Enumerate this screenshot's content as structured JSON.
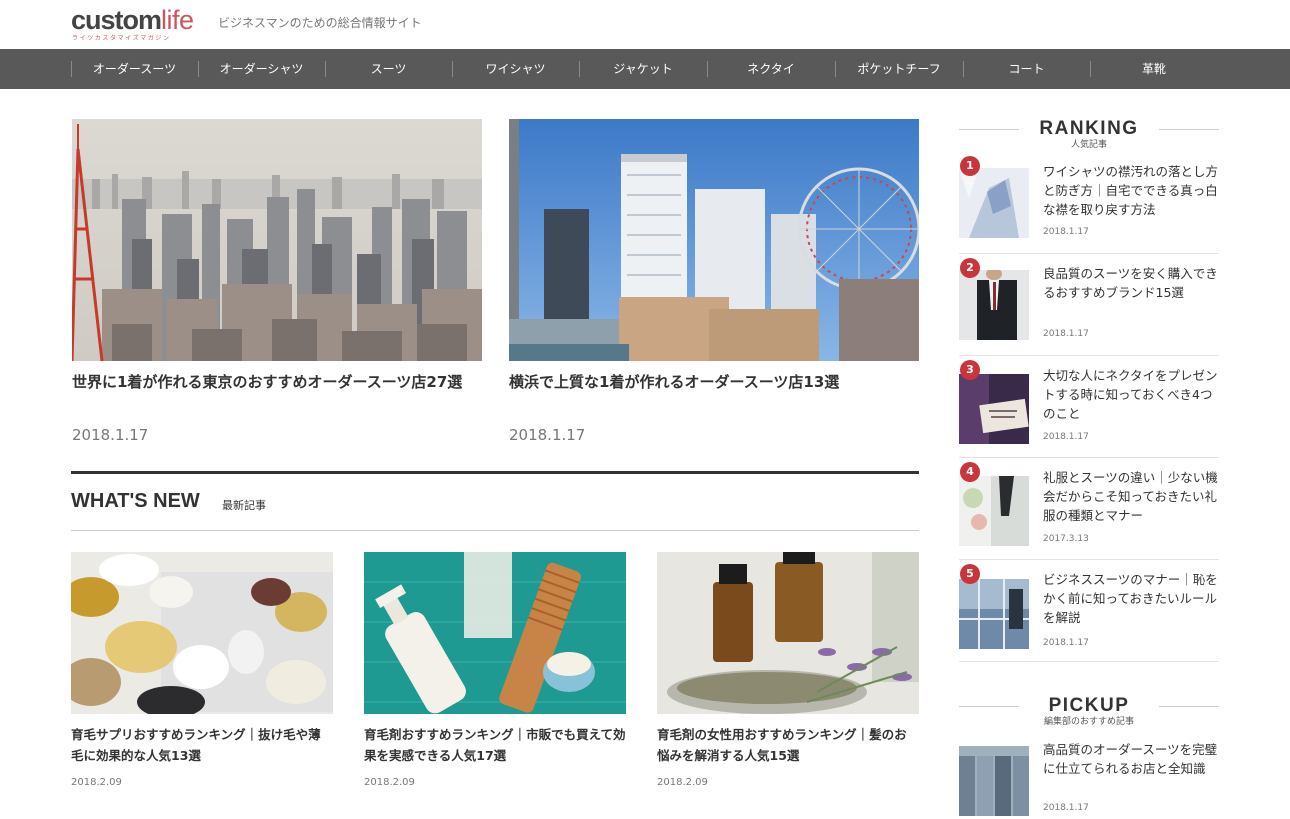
{
  "header": {
    "logo_main": "custom",
    "logo_accent": "life",
    "logo_sub": "ライツカスタマイズマガジン",
    "tagline": "ビジネスマンのための総合情報サイト"
  },
  "nav": {
    "items": [
      "オーダースーツ",
      "オーダーシャツ",
      "スーツ",
      "ワイシャツ",
      "ジャケット",
      "ネクタイ",
      "ポケットチーフ",
      "コート",
      "革靴"
    ]
  },
  "featured": [
    {
      "title": "世界に1着が作れる東京のおすすめオーダースーツ店27選",
      "date": "2018.1.17"
    },
    {
      "title": "横浜で上質な1着が作れるオーダースーツ店13選",
      "date": "2018.1.17"
    }
  ],
  "whats_new": {
    "title": "WHAT'S NEW",
    "subtitle": "最新記事",
    "cards": [
      {
        "title": "育毛サプリおすすめランキング｜抜け毛や薄毛に効果的な人気13選",
        "date": "2018.2.09"
      },
      {
        "title": "育毛剤おすすめランキング｜市販でも買えて効果を実感できる人気17選",
        "date": "2018.2.09"
      },
      {
        "title": "育毛剤の女性用おすすめランキング｜髪のお悩みを解消する人気15選",
        "date": "2018.2.09"
      }
    ]
  },
  "ranking": {
    "title": "RANKING",
    "subtitle": "人気記事",
    "items": [
      {
        "rank": "1",
        "title": "ワイシャツの襟汚れの落とし方と防ぎ方｜自宅でできる真っ白な襟を取り戻す方法",
        "date": "2018.1.17"
      },
      {
        "rank": "2",
        "title": "良品質のスーツを安く購入できるおすすめブランド15選",
        "date": "2018.1.17"
      },
      {
        "rank": "3",
        "title": "大切な人にネクタイをプレゼントする時に知っておくべき4つのこと",
        "date": "2018.1.17"
      },
      {
        "rank": "4",
        "title": "礼服とスーツの違い｜少ない機会だからこそ知っておきたい礼服の種類とマナー",
        "date": "2017.3.13"
      },
      {
        "rank": "5",
        "title": "ビジネススーツのマナー｜恥をかく前に知っておきたいルールを解説",
        "date": "2018.1.17"
      }
    ]
  },
  "pickup": {
    "title": "PICKUP",
    "subtitle": "編集部のおすすめ記事",
    "items": [
      {
        "title": "高品質のオーダースーツを完璧に仕立てられるお店と全知識",
        "date": "2018.1.17"
      }
    ]
  },
  "colors": {
    "nav_bg": "#595959",
    "accent": "#c9585e",
    "rank_badge": "#c9353c"
  }
}
